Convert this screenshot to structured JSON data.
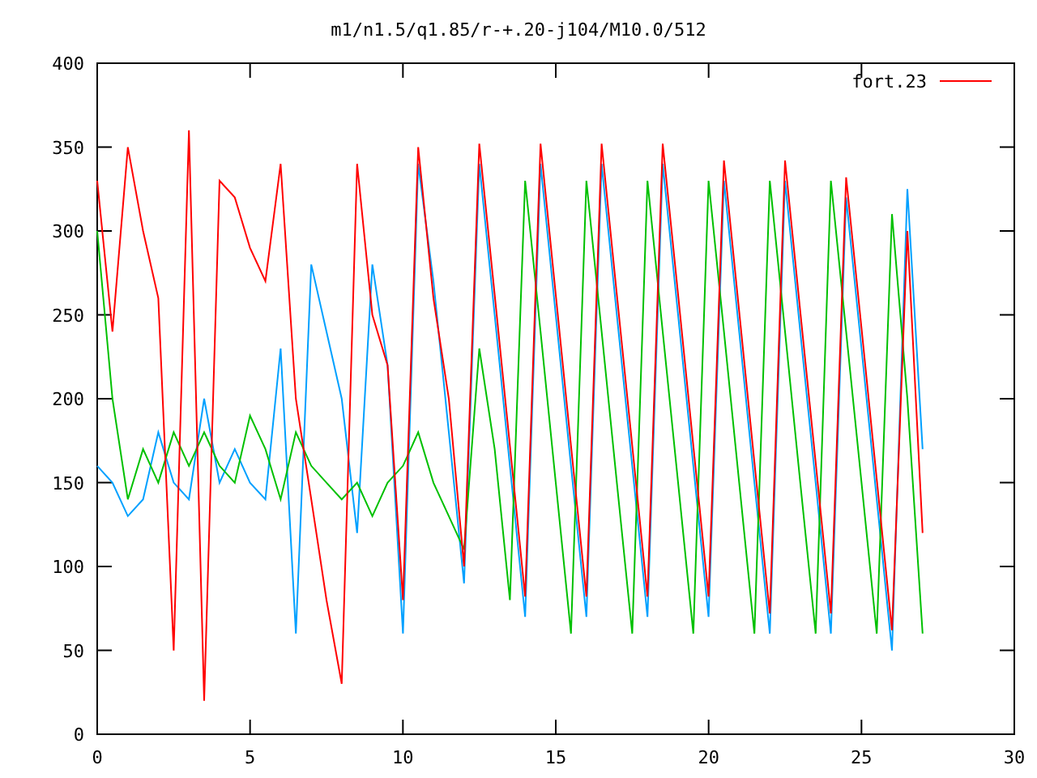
{
  "plot": {
    "chart_data": {
      "type": "line",
      "title": "m1/n1.5/q1.85/r-+.20-j104/M10.0/512",
      "xlim": [
        0,
        30
      ],
      "ylim": [
        0,
        400
      ],
      "xticks": [
        0,
        5,
        10,
        15,
        20,
        25,
        30
      ],
      "yticks": [
        0,
        50,
        100,
        150,
        200,
        250,
        300,
        350,
        400
      ],
      "x": [
        0,
        0.5,
        1,
        1.5,
        2,
        2.5,
        3,
        3.5,
        4,
        4.5,
        5,
        5.5,
        6,
        6.5,
        7,
        7.5,
        8,
        8.5,
        9,
        9.5,
        10,
        10.5,
        11,
        11.5,
        12,
        12.5,
        13,
        13.5,
        14,
        14.5,
        15,
        15.5,
        16,
        16.5,
        17,
        17.5,
        18,
        18.5,
        19,
        19.5,
        20,
        20.5,
        21,
        21.5,
        22,
        22.5,
        23,
        23.5,
        24,
        24.5,
        25,
        25.5,
        26,
        26.5,
        27
      ],
      "series": [
        {
          "color": "#00a0ff",
          "values": [
            160,
            150,
            130,
            140,
            180,
            150,
            140,
            200,
            150,
            170,
            150,
            140,
            230,
            60,
            280,
            240,
            200,
            120,
            280,
            220,
            60,
            340,
            270,
            180,
            90,
            340,
            250,
            160,
            70,
            340,
            250,
            160,
            70,
            340,
            250,
            160,
            70,
            340,
            250,
            160,
            70,
            330,
            240,
            150,
            60,
            330,
            240,
            150,
            60,
            320,
            230,
            140,
            50,
            325,
            170
          ]
        },
        {
          "color": "#00c000",
          "values": [
            300,
            200,
            140,
            170,
            150,
            180,
            160,
            180,
            160,
            150,
            190,
            170,
            140,
            180,
            160,
            150,
            140,
            150,
            130,
            150,
            160,
            180,
            150,
            130,
            110,
            230,
            170,
            80,
            330,
            240,
            150,
            60,
            330,
            240,
            150,
            60,
            330,
            240,
            150,
            60,
            330,
            240,
            150,
            60,
            330,
            240,
            150,
            60,
            330,
            240,
            150,
            60,
            310,
            200,
            60
          ]
        },
        {
          "name": "fort.23",
          "color": "#ff0000",
          "values": [
            330,
            240,
            350,
            300,
            260,
            50,
            360,
            20,
            330,
            320,
            290,
            270,
            340,
            200,
            140,
            80,
            30,
            340,
            250,
            220,
            80,
            350,
            260,
            200,
            100,
            352,
            262,
            172,
            82,
            352,
            262,
            172,
            82,
            352,
            262,
            172,
            82,
            352,
            262,
            172,
            82,
            342,
            252,
            162,
            72,
            342,
            252,
            162,
            72,
            332,
            242,
            152,
            62,
            300,
            120
          ]
        }
      ]
    }
  }
}
